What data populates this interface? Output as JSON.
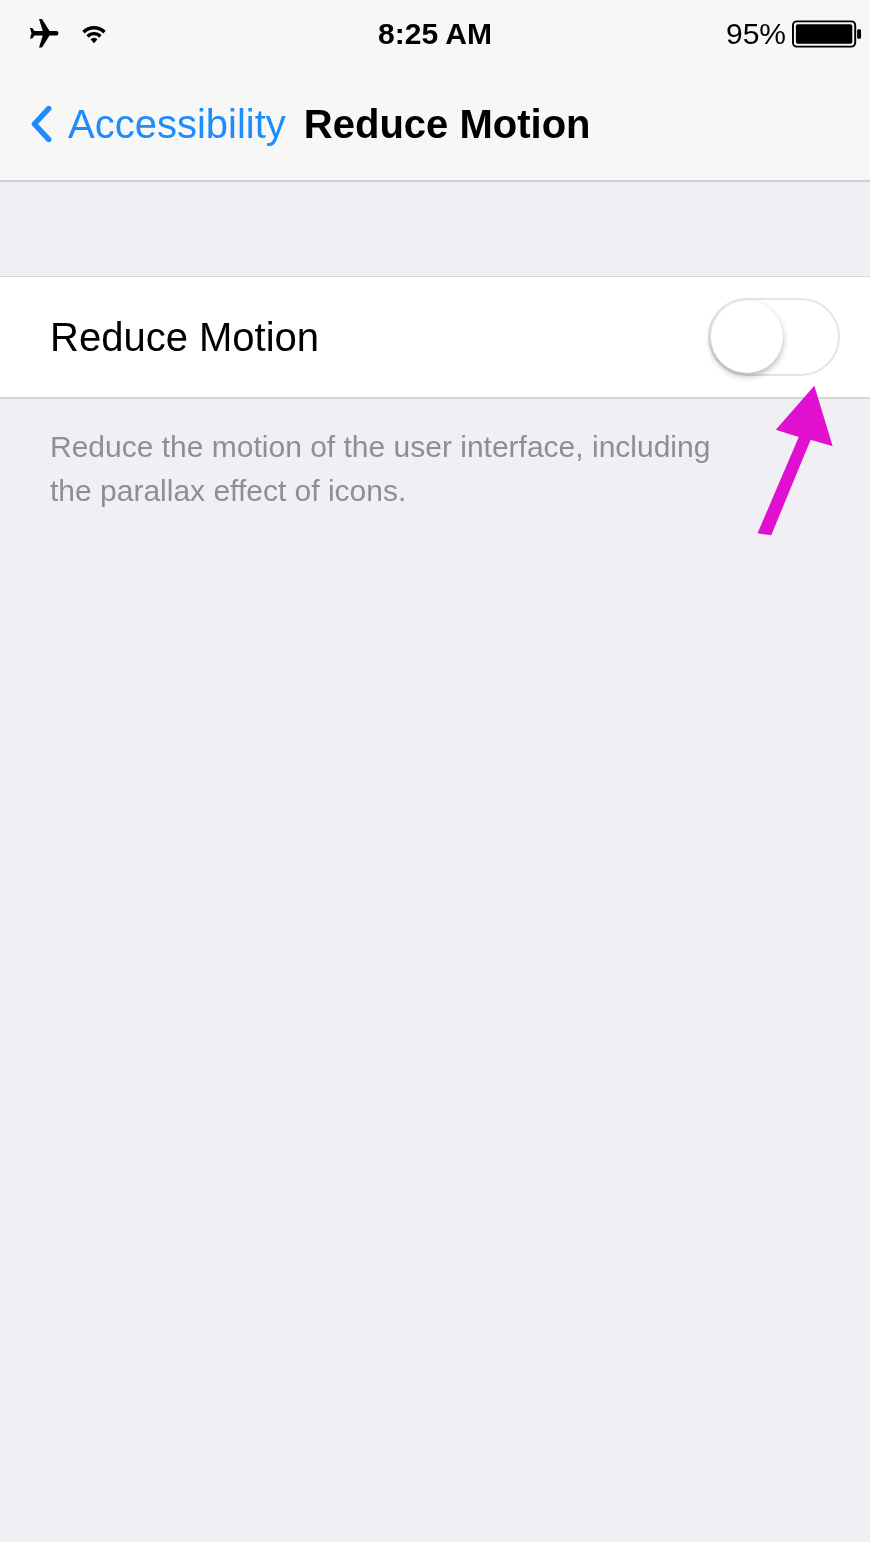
{
  "status_bar": {
    "time": "8:25 AM",
    "battery_percent": "95%"
  },
  "nav_bar": {
    "back_label": "Accessibility",
    "title": "Reduce Motion"
  },
  "settings": [
    {
      "label": "Reduce Motion",
      "on": false
    }
  ],
  "footer": "Reduce the motion of the user interface, including the parallax effect of icons."
}
